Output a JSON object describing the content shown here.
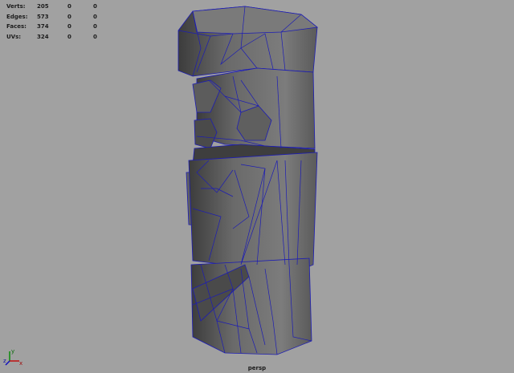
{
  "hud": {
    "rows": [
      {
        "label": "Verts:",
        "total": "205",
        "selected": "0",
        "highlighted": "0"
      },
      {
        "label": "Edges:",
        "total": "573",
        "selected": "0",
        "highlighted": "0"
      },
      {
        "label": "Faces:",
        "total": "374",
        "selected": "0",
        "highlighted": "0"
      },
      {
        "label": "UVs:",
        "total": "324",
        "selected": "0",
        "highlighted": "0"
      }
    ]
  },
  "camera": {
    "name": "persp"
  },
  "axis": {
    "y_label": "y",
    "z_label": "z",
    "x_label": "x"
  },
  "colors": {
    "background": "#a1a1a1",
    "wireframe": "#1a1ab0",
    "mesh": "#6e6e6e"
  }
}
